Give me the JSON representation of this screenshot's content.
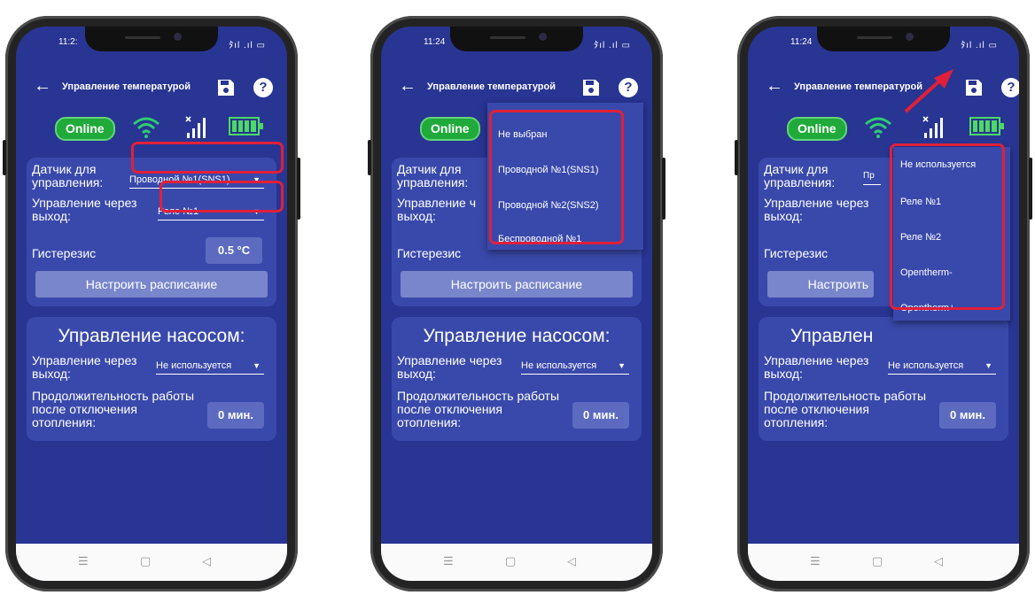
{
  "status": {
    "phone1_time": "11:2:",
    "phone2_time": "11:24",
    "phone3_time": "11:24",
    "signal": "ﾀıl .ıl ▭"
  },
  "appbar": {
    "title": "Управление температурой",
    "back": "←",
    "help": "?"
  },
  "indicators": {
    "online_label": "Online"
  },
  "heating": {
    "sensor_label": "Датчик для управления:",
    "sensor_value": "Проводной №1(SNS1)",
    "sensor_value_partial": "Пр",
    "output_label": "Управление через выход:",
    "output_label_partial": "Управление ч выход:",
    "output_value": "Реле №1",
    "hysteresis_label": "Гистерезис",
    "hysteresis_value": "0.5 °C",
    "schedule_button": "Настроить расписание",
    "schedule_button_partial": "Настроить"
  },
  "pump": {
    "title": "Управление насосом:",
    "title_partial": "Управлен",
    "output_label": "Управление через выход:",
    "output_value": "Не используется",
    "duration_label": "Продолжительность работы после отключения отопления:",
    "duration_value": "0 мин."
  },
  "sensor_menu": {
    "items": [
      "Не выбран",
      "Проводной №1(SNS1)",
      "Проводной №2(SNS2)",
      "Беспроводной №1"
    ]
  },
  "output_menu": {
    "items": [
      "Не используется",
      "Реле №1",
      "Реле №2",
      "Opentherm-",
      "Opentherm+"
    ]
  },
  "navbar": {
    "recent": "☰",
    "home": "▢",
    "back": "◁"
  },
  "colors": {
    "screen_bg": "#283593",
    "card_bg": "#3949ab",
    "online_green": "#1faa3a",
    "highlight_red": "#e0203a"
  }
}
